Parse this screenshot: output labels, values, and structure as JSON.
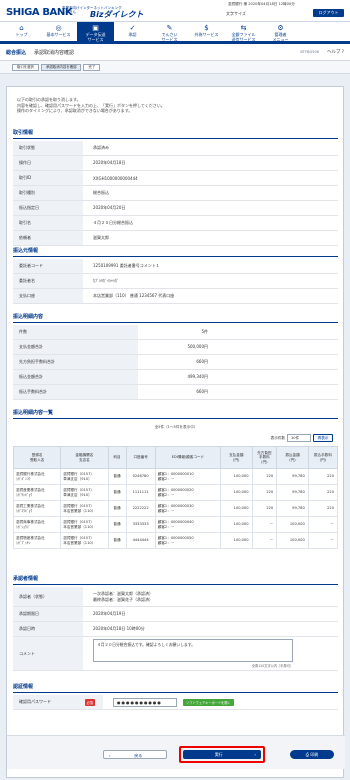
{
  "header": {
    "brand": "SHIGA BANK",
    "tagline_1": "事業者向けインターネットバンキング",
    "tagline_2": "しがぎん",
    "biz": "Bizダイレクト",
    "user_info": "滋賀銀行 様 2020年04月18日 12時00分",
    "lang": "文字サイズ",
    "logout": "ログアウト"
  },
  "nav": [
    {
      "label": "トップ",
      "icon": "⌂",
      "active": false
    },
    {
      "label": "基本サービス",
      "icon": "◎",
      "active": false
    },
    {
      "label": "データ伝送\nサービス",
      "icon": "▣",
      "active": true
    },
    {
      "label": "承認",
      "icon": "✓",
      "active": false
    },
    {
      "label": "でんさい\nサービス",
      "icon": "✎",
      "active": false
    },
    {
      "label": "外為サービス",
      "icon": "$",
      "active": false
    },
    {
      "label": "全銀ファイル\n送信サービス",
      "icon": "⇆",
      "active": false
    },
    {
      "label": "管理者\nメニュー",
      "icon": "⚙",
      "active": false
    }
  ],
  "page": {
    "category": "総合振込",
    "title": "承認取消内容確認",
    "code": "BTFBG506",
    "help": "ヘルプ ?"
  },
  "steps": [
    "取引を選択",
    "承認取消内容を確認",
    "完了"
  ],
  "intro": [
    "以下の取引の承認を取り消します。",
    "内容を確認し、確認用パスワードを入力の上、「実行」ボタンを押してください。",
    "操作のタイミングにより、承認取消ができない場合があります。"
  ],
  "trade": {
    "heading": "取引情報",
    "rows": [
      {
        "k": "取引状態",
        "v": "承認済み"
      },
      {
        "k": "操作日",
        "v": "2020年04月18日"
      },
      {
        "k": "取引ID",
        "v": "XXGH1000000000444"
      },
      {
        "k": "取引種別",
        "v": "総合振込"
      },
      {
        "k": "振込指定日",
        "v": "2020年04月20日"
      },
      {
        "k": "取引名",
        "v": "４月２０日分総合振込"
      },
      {
        "k": "依頼者",
        "v": "滋賀太郎"
      }
    ]
  },
  "source": {
    "heading": "振込元情報",
    "rows": [
      {
        "k": "委託者コード",
        "v": "1250109991 委託者番号コメント１"
      },
      {
        "k": "委託者名",
        "v": "ｶﾌﾞｼｷｶﾞｲｼｬｼｶﾞ"
      },
      {
        "k": "支払口座",
        "v": "本店営業部（110） 普通 1234567 代表口座"
      }
    ]
  },
  "details": {
    "heading": "振込明細内容",
    "rows": [
      {
        "k": "件数",
        "v": "5件"
      },
      {
        "k": "支払金額合計",
        "v": "500,000円"
      },
      {
        "k": "先方負担手数料合計",
        "v": "660円"
      },
      {
        "k": "振込金額合計",
        "v": "499,340円"
      },
      {
        "k": "振込手数料合計",
        "v": "660円"
      }
    ]
  },
  "list": {
    "heading": "振込明細内容一覧",
    "count": "全5件（1～5件を表示中）",
    "pages_label": "表示件数",
    "pages_value": "10件",
    "refresh": "再表示",
    "cols": [
      "登録名\n受取人名",
      "金融機関名\n支店名",
      "科目",
      "口座番号",
      "EDI情報/顧客コード",
      "支払金額\n(円)",
      "先方負担\n手数料\n(円)",
      "振込金額\n(円)",
      "振込手数料\n(円)"
    ],
    "rows": [
      [
        "滋賀銀行株式会社\nｼｶﾞｷﾞﾝｺｳ",
        "滋賀銀行（0157）\n草津支店（910）",
        "普通",
        "0246780",
        "顧客1：0000000010\n顧客2：－",
        "100,000",
        "220",
        "99,780",
        "220"
      ],
      [
        "滋賀産業株式会社\nｼｶﾞｻﾝｷﾞｮｳ",
        "滋賀銀行（0157）\n草津支店（910）",
        "普通",
        "1111111",
        "顧客1：0000000020\n顧客2：－",
        "100,000",
        "220",
        "99,780",
        "220"
      ],
      [
        "滋賀工業株式会社\nｼｶﾞｺｳｷﾞｮｳ",
        "滋賀銀行（0157）\n本店営業部（110）",
        "普通",
        "2222222",
        "顧客1：0000000030\n顧客2：－",
        "100,000",
        "220",
        "99,780",
        "220"
      ],
      [
        "滋賀商事株式会社\nｼｶﾞｼｮｳｼﾞ",
        "滋賀銀行（0157）\n本店営業部（110）",
        "普通",
        "3333333",
        "顧客1：0000000040\n顧客2：－",
        "100,000",
        "－",
        "100,000",
        "－"
      ],
      [
        "滋賀物産株式会社\nｼｶﾞﾌﾞｯｻﾝ",
        "滋賀銀行（0157）\n本店営業部（110）",
        "普通",
        "4444444",
        "顧客1：0000000050\n顧客2：－",
        "100,000",
        "－",
        "100,000",
        "－"
      ]
    ]
  },
  "approver": {
    "heading": "承認者情報",
    "rows": [
      {
        "k": "承認者（状態）",
        "v": "一次承認者：滋賀太郎（承認済）\n最終承認者：滋賀花子（承認済）"
      },
      {
        "k": "承認期限日",
        "v": "2020年04月19日"
      },
      {
        "k": "承認日時",
        "v": "2020年04月18日 10時00分"
      }
    ],
    "comment_label": "コメント",
    "comment": "４月２０日分総合振込です。確認よろしくお願いします。",
    "comment_note": "全角120文字以内［半角可］"
  },
  "auth": {
    "heading": "認証情報",
    "label": "確認用パスワード",
    "required": "必須",
    "value": "●●●●●●●●●●",
    "keyboard": "ソフトウェアキーボードを開く"
  },
  "buttons": {
    "back": "戻る",
    "execute": "実行",
    "print": "印刷"
  }
}
